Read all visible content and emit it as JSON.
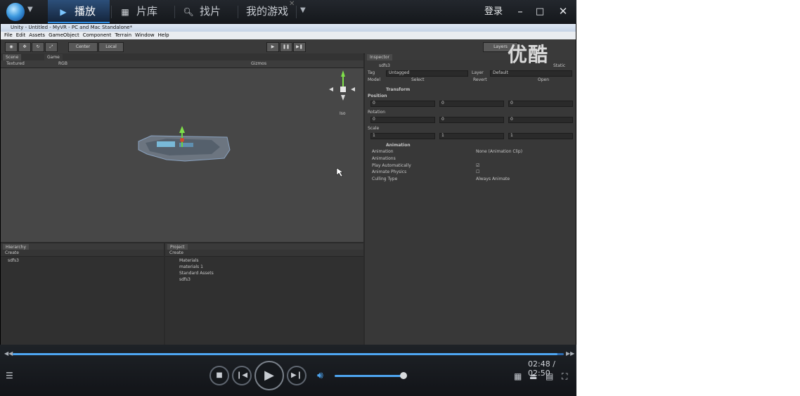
{
  "topbar": {
    "tabs": [
      {
        "label": "播放",
        "icon": "play-icon"
      },
      {
        "label": "片库",
        "icon": "grid-icon"
      },
      {
        "label": "找片",
        "icon": "search-icon"
      },
      {
        "label": "我的游戏",
        "icon": ""
      }
    ],
    "login_label": "登录",
    "window_buttons": [
      "–",
      "□",
      "✕"
    ]
  },
  "video": {
    "watermark": "优酷",
    "unity": {
      "title": "Unity - Untitled - MyVR - PC and Mac Standalone*",
      "menu": [
        "File",
        "Edit",
        "Assets",
        "GameObject",
        "Component",
        "Terrain",
        "Window",
        "Help"
      ],
      "toolbar": {
        "center": "Center",
        "local": "Local",
        "layers": "Layers"
      },
      "scene_tabs": [
        "Scene",
        "Game"
      ],
      "scene_bar": {
        "textured": "Textured",
        "rgb": "RGB",
        "gizmos": "Gizmos"
      },
      "gizmo_label": "Iso",
      "inspector": {
        "tab": "Inspector",
        "object_name": "sdfs3",
        "static_label": "Static",
        "tag_label": "Tag",
        "tag_value": "Untagged",
        "layer_label": "Layer",
        "layer_value": "Default",
        "model_label": "Model",
        "model_buttons": [
          "Select",
          "Revert",
          "Open"
        ],
        "transform_label": "Transform",
        "position_label": "Position",
        "rotation_label": "Rotation",
        "scale_label": "Scale",
        "position": {
          "x": "0",
          "y": "0",
          "z": "0"
        },
        "rotation": {
          "x": "0",
          "y": "0",
          "z": "0"
        },
        "scale": {
          "x": "1",
          "y": "1",
          "z": "1"
        },
        "animation_label": "Animation",
        "animation_rows": [
          {
            "label": "Animation",
            "value": "None (Animation Clip)"
          },
          {
            "label": "Animations",
            "value": ""
          },
          {
            "label": "Play Automatically",
            "value": "☑"
          },
          {
            "label": "Animate Physics",
            "value": "☐"
          },
          {
            "label": "Culling Type",
            "value": "Always Animate"
          }
        ]
      },
      "hierarchy": {
        "tab": "Hierarchy",
        "create": "Create",
        "items": [
          "sdfs3"
        ]
      },
      "project": {
        "tab": "Project",
        "create": "Create",
        "items": [
          "Materials",
          "materials 1",
          "Standard Assets",
          "sdfs3"
        ]
      }
    }
  },
  "controls": {
    "time_current": "02:48",
    "time_total": "02:50",
    "time_display": "02:48 / 02:50",
    "progress_fraction": 0.988,
    "volume_fraction": 0.98
  },
  "colors": {
    "accent": "#4ea6f2",
    "background": "#101216"
  }
}
